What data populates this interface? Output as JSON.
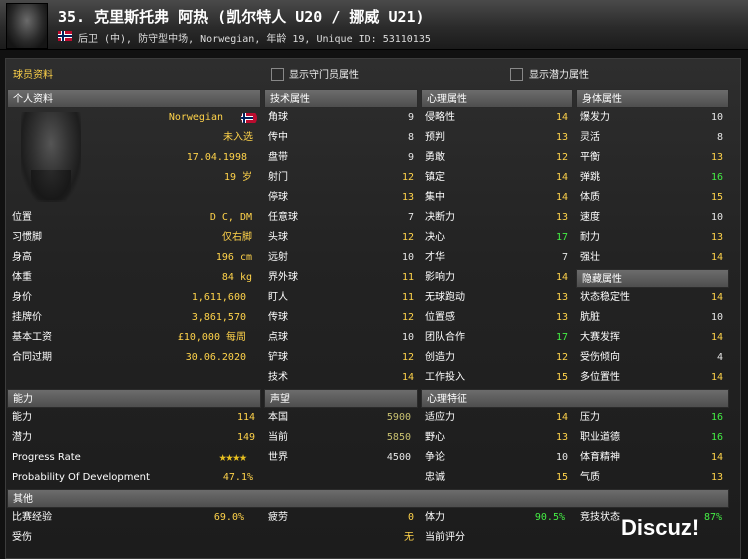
{
  "header": {
    "title": "35. 克里斯托弗 阿热 (凯尔特人 U20 / 挪威 U21)",
    "subtitle": "后卫 (中), 防守型中场, Norwegian, 年龄 19, Unique ID: 53110135"
  },
  "tabs": {
    "active": "球员资料",
    "show_gk": "显示守门员属性",
    "show_potential": "显示潜力属性"
  },
  "personal": {
    "header": "个人资料",
    "nationality": "Norwegian",
    "selection": "未入选",
    "dob": "17.04.1998",
    "age": "19 岁",
    "rows": [
      {
        "label": "位置",
        "value": "D C, DM"
      },
      {
        "label": "习惯脚",
        "value": "仅右脚"
      },
      {
        "label": "身高",
        "value": "196 cm"
      },
      {
        "label": "体重",
        "value": "84 kg"
      },
      {
        "label": "身价",
        "value": "1,611,600"
      },
      {
        "label": "挂牌价",
        "value": "3,861,570"
      },
      {
        "label": "基本工资",
        "value": "£10,000 每周"
      },
      {
        "label": "合同过期",
        "value": "30.06.2020"
      }
    ]
  },
  "technical": {
    "header": "技术属性",
    "rows": [
      {
        "label": "角球",
        "value": "9"
      },
      {
        "label": "传中",
        "value": "8"
      },
      {
        "label": "盘带",
        "value": "9"
      },
      {
        "label": "射门",
        "value": "12"
      },
      {
        "label": "停球",
        "value": "13"
      },
      {
        "label": "任意球",
        "value": "7"
      },
      {
        "label": "头球",
        "value": "12"
      },
      {
        "label": "远射",
        "value": "10"
      },
      {
        "label": "界外球",
        "value": "11"
      },
      {
        "label": "盯人",
        "value": "11"
      },
      {
        "label": "传球",
        "value": "12"
      },
      {
        "label": "点球",
        "value": "10"
      },
      {
        "label": "铲球",
        "value": "12"
      },
      {
        "label": "技术",
        "value": "14"
      }
    ]
  },
  "mental": {
    "header": "心理属性",
    "rows": [
      {
        "label": "侵略性",
        "value": "14"
      },
      {
        "label": "预判",
        "value": "13"
      },
      {
        "label": "勇敢",
        "value": "12"
      },
      {
        "label": "镇定",
        "value": "14"
      },
      {
        "label": "集中",
        "value": "14"
      },
      {
        "label": "决断力",
        "value": "13"
      },
      {
        "label": "决心",
        "value": "17"
      },
      {
        "label": "才华",
        "value": "7"
      },
      {
        "label": "影响力",
        "value": "14"
      },
      {
        "label": "无球跑动",
        "value": "13"
      },
      {
        "label": "位置感",
        "value": "13"
      },
      {
        "label": "团队合作",
        "value": "17"
      },
      {
        "label": "创造力",
        "value": "12"
      },
      {
        "label": "工作投入",
        "value": "15"
      }
    ]
  },
  "physical": {
    "header": "身体属性",
    "rows": [
      {
        "label": "爆发力",
        "value": "10"
      },
      {
        "label": "灵活",
        "value": "8"
      },
      {
        "label": "平衡",
        "value": "13"
      },
      {
        "label": "弹跳",
        "value": "16"
      },
      {
        "label": "体质",
        "value": "15"
      },
      {
        "label": "速度",
        "value": "10"
      },
      {
        "label": "耐力",
        "value": "13"
      },
      {
        "label": "强壮",
        "value": "14"
      }
    ]
  },
  "hidden": {
    "header": "隐藏属性",
    "rows": [
      {
        "label": "状态稳定性",
        "value": "14"
      },
      {
        "label": "肮脏",
        "value": "10"
      },
      {
        "label": "大赛发挥",
        "value": "14"
      },
      {
        "label": "受伤倾向",
        "value": "4"
      },
      {
        "label": "多位置性",
        "value": "14"
      }
    ]
  },
  "ability": {
    "header": "能力",
    "rows": [
      {
        "label": "能力",
        "value": "114"
      },
      {
        "label": "潜力",
        "value": "149"
      },
      {
        "label": "Progress Rate",
        "value": "★★★★"
      },
      {
        "label": "Probability Of Development",
        "value": "47.1%"
      }
    ],
    "progress_stars": 4
  },
  "reputation": {
    "header": "声望",
    "rows": [
      {
        "label": "本国",
        "value": "5900"
      },
      {
        "label": "当前",
        "value": "5850"
      },
      {
        "label": "世界",
        "value": "4500"
      }
    ]
  },
  "traits": {
    "header": "心理特征",
    "rows": [
      {
        "label": "适应力",
        "value": "14"
      },
      {
        "label": "野心",
        "value": "13"
      },
      {
        "label": "争论",
        "value": "10"
      },
      {
        "label": "忠诚",
        "value": "15"
      }
    ],
    "rows2": [
      {
        "label": "压力",
        "value": "16"
      },
      {
        "label": "职业道德",
        "value": "16"
      },
      {
        "label": "体育精神",
        "value": "14"
      },
      {
        "label": "气质",
        "value": "13"
      }
    ]
  },
  "other": {
    "header": "其他",
    "rows": [
      {
        "label": "比赛经验",
        "value": "69.0%"
      },
      {
        "label": "疲劳",
        "value": "0"
      },
      {
        "label": "体力",
        "value": "90.5%"
      },
      {
        "label": "竞技状态",
        "value": "87%"
      },
      {
        "label": "受伤",
        "value": "无"
      },
      {
        "label": "当前评分",
        "value": ""
      }
    ]
  },
  "watermark": "Discuz!"
}
